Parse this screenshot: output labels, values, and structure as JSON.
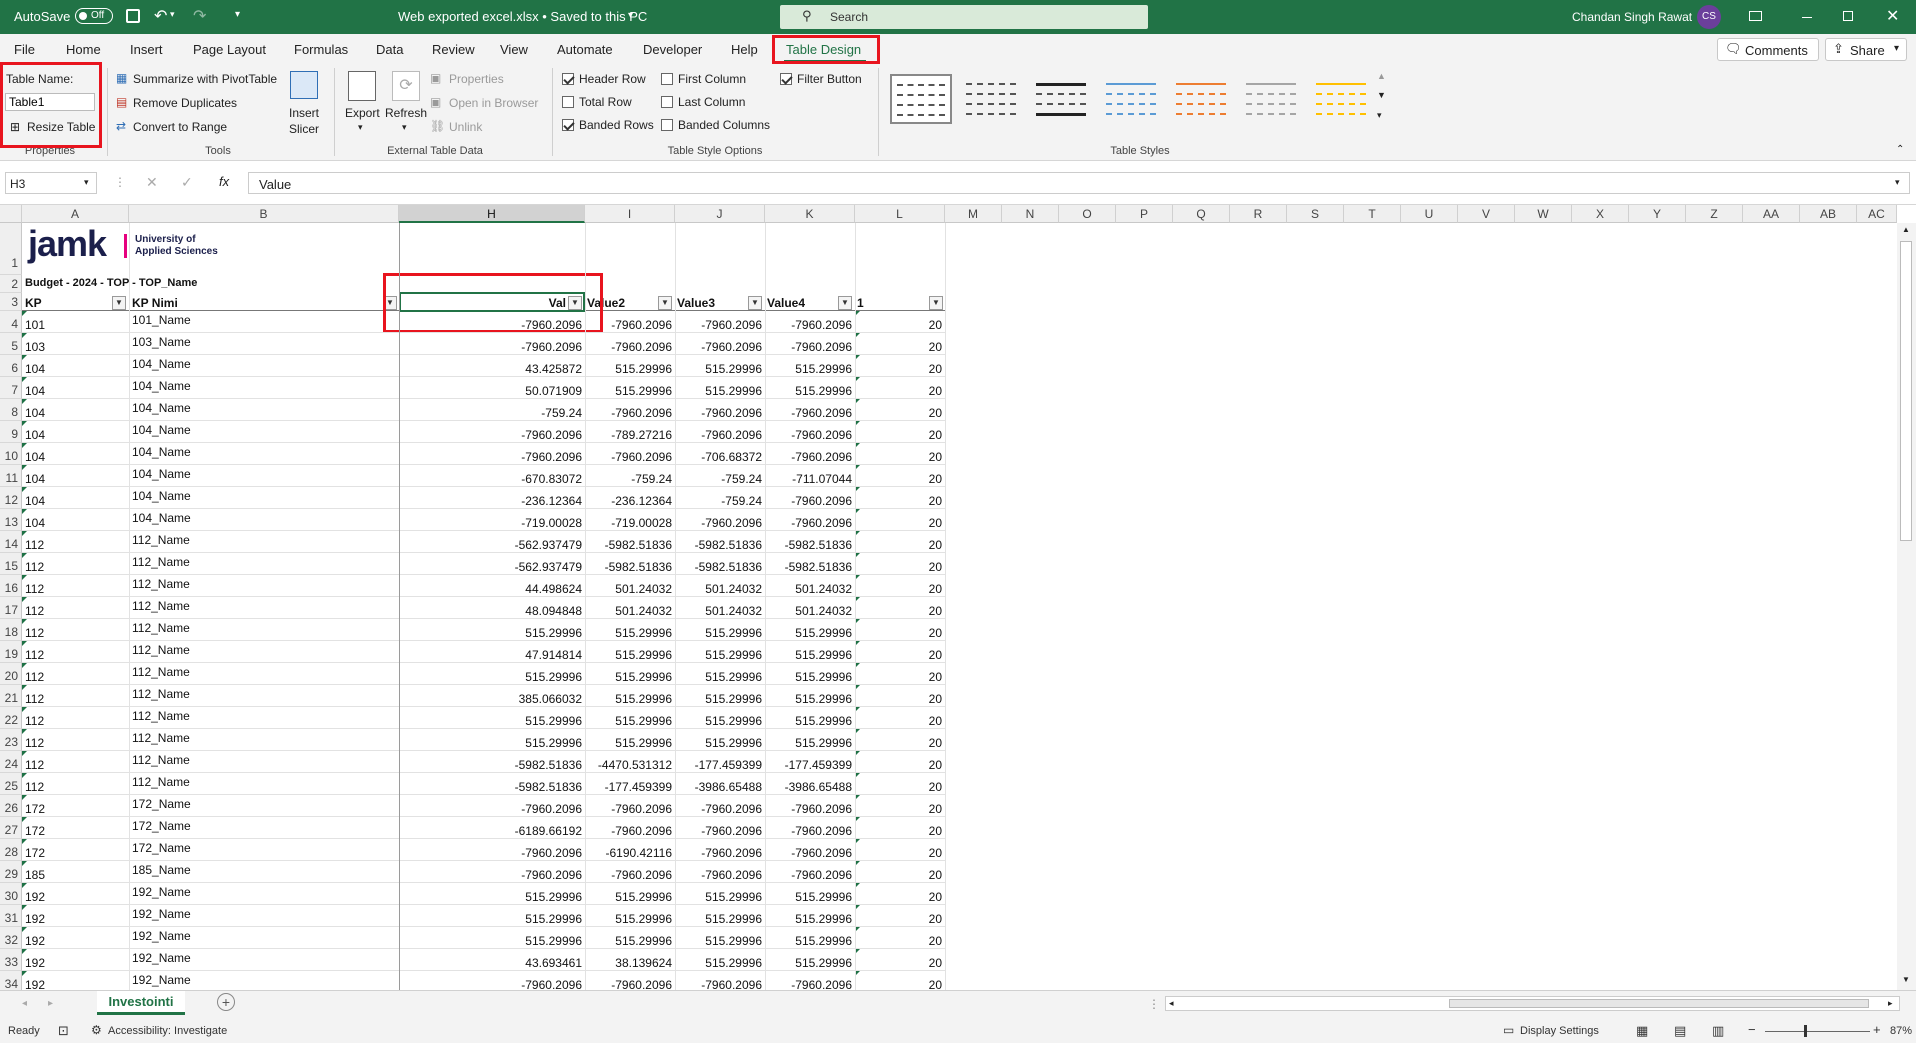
{
  "titlebar": {
    "autosave": "AutoSave",
    "autosave_state": "Off",
    "doc_title": "Web exported excel.xlsx • Saved to this PC",
    "search_placeholder": "Search",
    "user": "Chandan Singh Rawat",
    "user_initials": "CS"
  },
  "menu": [
    "File",
    "Home",
    "Insert",
    "Page Layout",
    "Formulas",
    "Data",
    "Review",
    "View",
    "Automate",
    "Developer",
    "Help",
    "Table Design"
  ],
  "menu_right": {
    "comments": "Comments",
    "share": "Share"
  },
  "ribbon": {
    "properties": {
      "table_name_label": "Table Name:",
      "table_name_value": "Table1",
      "resize": "Resize Table",
      "group": "Properties"
    },
    "tools": {
      "summarize": "Summarize with PivotTable",
      "remove_dup": "Remove Duplicates",
      "convert": "Convert to Range",
      "insert_slicer_1": "Insert",
      "insert_slicer_2": "Slicer",
      "group": "Tools"
    },
    "external": {
      "export": "Export",
      "refresh": "Refresh",
      "properties": "Properties",
      "open_browser": "Open in Browser",
      "unlink": "Unlink",
      "group": "External Table Data"
    },
    "options": {
      "header_row": "Header Row",
      "total_row": "Total Row",
      "banded_rows": "Banded Rows",
      "first_column": "First Column",
      "last_column": "Last Column",
      "banded_columns": "Banded Columns",
      "filter_button": "Filter Button",
      "group": "Table Style Options"
    },
    "styles": {
      "group": "Table Styles",
      "swatches": [
        "#444444",
        "#444444",
        "#222222",
        "#5b9bd5",
        "#ed7d31",
        "#a5a5a5",
        "#ffc000"
      ]
    }
  },
  "formula_bar": {
    "name_box": "H3",
    "fx": "fx",
    "content": "Value"
  },
  "columns": [
    "A",
    "B",
    "H",
    "I",
    "J",
    "K",
    "L",
    "M",
    "N",
    "O",
    "P",
    "Q",
    "R",
    "S",
    "T",
    "U",
    "V",
    "W",
    "X",
    "Y",
    "Z",
    "AA",
    "AB",
    "AC"
  ],
  "logo": {
    "word": "jamk",
    "line1": "University of",
    "line2": "Applied Sciences"
  },
  "row2_text": "Budget - 2024 - TOP - TOP_Name",
  "headers": {
    "a": "KP",
    "b": "KP Nimi",
    "h": "Val",
    "i": "Value2",
    "j": "Value3",
    "k": "Value4",
    "l": "1"
  },
  "rows": [
    {
      "n": "4",
      "a": "101",
      "b": "101_Name",
      "h": "-7960.2096",
      "i": "-7960.2096",
      "j": "-7960.2096",
      "k": "-7960.2096",
      "l": "20"
    },
    {
      "n": "5",
      "a": "103",
      "b": "103_Name",
      "h": "-7960.2096",
      "i": "-7960.2096",
      "j": "-7960.2096",
      "k": "-7960.2096",
      "l": "20"
    },
    {
      "n": "6",
      "a": "104",
      "b": "104_Name",
      "h": "43.425872",
      "i": "515.29996",
      "j": "515.29996",
      "k": "515.29996",
      "l": "20"
    },
    {
      "n": "7",
      "a": "104",
      "b": "104_Name",
      "h": "50.071909",
      "i": "515.29996",
      "j": "515.29996",
      "k": "515.29996",
      "l": "20"
    },
    {
      "n": "8",
      "a": "104",
      "b": "104_Name",
      "h": "-759.24",
      "i": "-7960.2096",
      "j": "-7960.2096",
      "k": "-7960.2096",
      "l": "20"
    },
    {
      "n": "9",
      "a": "104",
      "b": "104_Name",
      "h": "-7960.2096",
      "i": "-789.27216",
      "j": "-7960.2096",
      "k": "-7960.2096",
      "l": "20"
    },
    {
      "n": "10",
      "a": "104",
      "b": "104_Name",
      "h": "-7960.2096",
      "i": "-7960.2096",
      "j": "-706.68372",
      "k": "-7960.2096",
      "l": "20"
    },
    {
      "n": "11",
      "a": "104",
      "b": "104_Name",
      "h": "-670.83072",
      "i": "-759.24",
      "j": "-759.24",
      "k": "-711.07044",
      "l": "20"
    },
    {
      "n": "12",
      "a": "104",
      "b": "104_Name",
      "h": "-236.12364",
      "i": "-236.12364",
      "j": "-759.24",
      "k": "-7960.2096",
      "l": "20"
    },
    {
      "n": "13",
      "a": "104",
      "b": "104_Name",
      "h": "-719.00028",
      "i": "-719.00028",
      "j": "-7960.2096",
      "k": "-7960.2096",
      "l": "20"
    },
    {
      "n": "14",
      "a": "112",
      "b": "112_Name",
      "h": "-562.937479",
      "i": "-5982.51836",
      "j": "-5982.51836",
      "k": "-5982.51836",
      "l": "20"
    },
    {
      "n": "15",
      "a": "112",
      "b": "112_Name",
      "h": "-562.937479",
      "i": "-5982.51836",
      "j": "-5982.51836",
      "k": "-5982.51836",
      "l": "20"
    },
    {
      "n": "16",
      "a": "112",
      "b": "112_Name",
      "h": "44.498624",
      "i": "501.24032",
      "j": "501.24032",
      "k": "501.24032",
      "l": "20"
    },
    {
      "n": "17",
      "a": "112",
      "b": "112_Name",
      "h": "48.094848",
      "i": "501.24032",
      "j": "501.24032",
      "k": "501.24032",
      "l": "20"
    },
    {
      "n": "18",
      "a": "112",
      "b": "112_Name",
      "h": "515.29996",
      "i": "515.29996",
      "j": "515.29996",
      "k": "515.29996",
      "l": "20"
    },
    {
      "n": "19",
      "a": "112",
      "b": "112_Name",
      "h": "47.914814",
      "i": "515.29996",
      "j": "515.29996",
      "k": "515.29996",
      "l": "20"
    },
    {
      "n": "20",
      "a": "112",
      "b": "112_Name",
      "h": "515.29996",
      "i": "515.29996",
      "j": "515.29996",
      "k": "515.29996",
      "l": "20"
    },
    {
      "n": "21",
      "a": "112",
      "b": "112_Name",
      "h": "385.066032",
      "i": "515.29996",
      "j": "515.29996",
      "k": "515.29996",
      "l": "20"
    },
    {
      "n": "22",
      "a": "112",
      "b": "112_Name",
      "h": "515.29996",
      "i": "515.29996",
      "j": "515.29996",
      "k": "515.29996",
      "l": "20"
    },
    {
      "n": "23",
      "a": "112",
      "b": "112_Name",
      "h": "515.29996",
      "i": "515.29996",
      "j": "515.29996",
      "k": "515.29996",
      "l": "20"
    },
    {
      "n": "24",
      "a": "112",
      "b": "112_Name",
      "h": "-5982.51836",
      "i": "-4470.531312",
      "j": "-177.459399",
      "k": "-177.459399",
      "l": "20"
    },
    {
      "n": "25",
      "a": "112",
      "b": "112_Name",
      "h": "-5982.51836",
      "i": "-177.459399",
      "j": "-3986.65488",
      "k": "-3986.65488",
      "l": "20"
    },
    {
      "n": "26",
      "a": "172",
      "b": "172_Name",
      "h": "-7960.2096",
      "i": "-7960.2096",
      "j": "-7960.2096",
      "k": "-7960.2096",
      "l": "20"
    },
    {
      "n": "27",
      "a": "172",
      "b": "172_Name",
      "h": "-6189.66192",
      "i": "-7960.2096",
      "j": "-7960.2096",
      "k": "-7960.2096",
      "l": "20"
    },
    {
      "n": "28",
      "a": "172",
      "b": "172_Name",
      "h": "-7960.2096",
      "i": "-6190.42116",
      "j": "-7960.2096",
      "k": "-7960.2096",
      "l": "20"
    },
    {
      "n": "29",
      "a": "185",
      "b": "185_Name",
      "h": "-7960.2096",
      "i": "-7960.2096",
      "j": "-7960.2096",
      "k": "-7960.2096",
      "l": "20"
    },
    {
      "n": "30",
      "a": "192",
      "b": "192_Name",
      "h": "515.29996",
      "i": "515.29996",
      "j": "515.29996",
      "k": "515.29996",
      "l": "20"
    },
    {
      "n": "31",
      "a": "192",
      "b": "192_Name",
      "h": "515.29996",
      "i": "515.29996",
      "j": "515.29996",
      "k": "515.29996",
      "l": "20"
    },
    {
      "n": "32",
      "a": "192",
      "b": "192_Name",
      "h": "515.29996",
      "i": "515.29996",
      "j": "515.29996",
      "k": "515.29996",
      "l": "20"
    },
    {
      "n": "33",
      "a": "192",
      "b": "192_Name",
      "h": "43.693461",
      "i": "38.139624",
      "j": "515.29996",
      "k": "515.29996",
      "l": "20"
    },
    {
      "n": "34",
      "a": "192",
      "b": "192_Name",
      "h": "-7960.2096",
      "i": "-7960.2096",
      "j": "-7960.2096",
      "k": "-7960.2096",
      "l": "20"
    }
  ],
  "sheet_tab": "Investointi",
  "status": {
    "ready": "Ready",
    "accessibility": "Accessibility: Investigate",
    "display_settings": "Display Settings",
    "zoom": "87%"
  },
  "colors": {
    "excel_green": "#217346",
    "highlight_red": "#e8141e",
    "logo_pink": "#e6007e",
    "logo_navy": "#1b1f4b"
  }
}
